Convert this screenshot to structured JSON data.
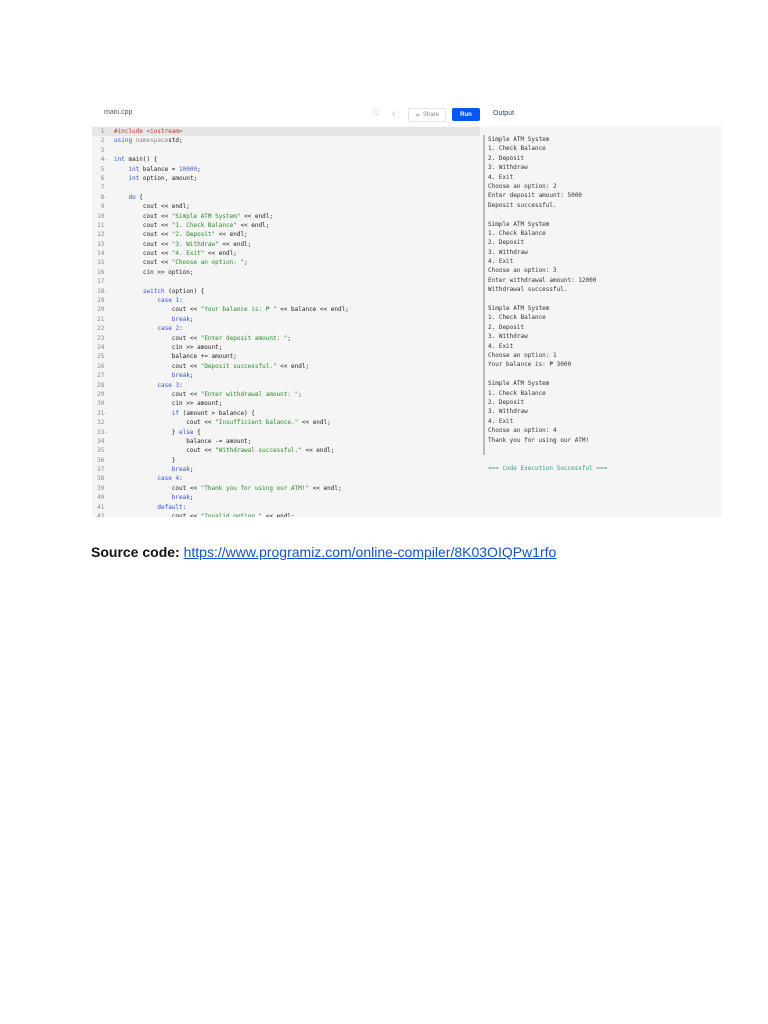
{
  "editor": {
    "filename": "main.cpp",
    "share_label": "Share",
    "run_label": "Run",
    "output_label": "Output"
  },
  "code": [
    [
      [
        "p",
        "#include <iostream>"
      ]
    ],
    [
      [
        "k",
        "using"
      ],
      [
        "g",
        " namespace"
      ],
      [
        "",
        "std;"
      ]
    ],
    [],
    [
      [
        "k",
        "int"
      ],
      [
        "",
        " main() {"
      ]
    ],
    [
      [
        "",
        "    "
      ],
      [
        "k",
        "int"
      ],
      [
        "",
        " balance = "
      ],
      [
        "n",
        "10000"
      ],
      [
        "",
        ";"
      ]
    ],
    [
      [
        "",
        "    "
      ],
      [
        "k",
        "int"
      ],
      [
        "",
        " option, amount;"
      ]
    ],
    [],
    [
      [
        "",
        "    "
      ],
      [
        "k",
        "do"
      ],
      [
        "",
        " {"
      ]
    ],
    [
      [
        "",
        "        cout << endl;"
      ]
    ],
    [
      [
        "",
        "        cout << "
      ],
      [
        "s",
        "\"Simple ATM System\""
      ],
      [
        "",
        " << endl;"
      ]
    ],
    [
      [
        "",
        "        cout << "
      ],
      [
        "s",
        "\"1. Check Balance\""
      ],
      [
        "",
        " << endl;"
      ]
    ],
    [
      [
        "",
        "        cout << "
      ],
      [
        "s",
        "\"2. Deposit\""
      ],
      [
        "",
        " << endl;"
      ]
    ],
    [
      [
        "",
        "        cout << "
      ],
      [
        "s",
        "\"3. Withdraw\""
      ],
      [
        "",
        " << endl;"
      ]
    ],
    [
      [
        "",
        "        cout << "
      ],
      [
        "s",
        "\"4. Exit\""
      ],
      [
        "",
        " << endl;"
      ]
    ],
    [
      [
        "",
        "        cout << "
      ],
      [
        "s",
        "\"Choose an option: \""
      ],
      [
        "",
        ";"
      ]
    ],
    [
      [
        "",
        "        cin >> option;"
      ]
    ],
    [],
    [
      [
        "",
        "        "
      ],
      [
        "k",
        "switch"
      ],
      [
        "",
        " (option) {"
      ]
    ],
    [
      [
        "",
        "            "
      ],
      [
        "k",
        "case"
      ],
      [
        " ",
        " "
      ],
      [
        "n",
        "1"
      ],
      [
        "",
        ":"
      ]
    ],
    [
      [
        "",
        "                cout << "
      ],
      [
        "s",
        "\"Your balance is: ₱ \""
      ],
      [
        "",
        " << balance << endl;"
      ]
    ],
    [
      [
        "",
        "                "
      ],
      [
        "k",
        "break"
      ],
      [
        "",
        ";"
      ]
    ],
    [
      [
        "",
        "            "
      ],
      [
        "k",
        "case"
      ],
      [
        "",
        " "
      ],
      [
        "n",
        "2"
      ],
      [
        "",
        ":"
      ]
    ],
    [
      [
        "",
        "                cout << "
      ],
      [
        "s",
        "\"Enter deposit amount: \""
      ],
      [
        "",
        ";"
      ]
    ],
    [
      [
        "",
        "                cin >> amount;"
      ]
    ],
    [
      [
        "",
        "                balance += amount;"
      ]
    ],
    [
      [
        "",
        "                cout << "
      ],
      [
        "s",
        "\"Deposit successful.\""
      ],
      [
        "",
        " << endl;"
      ]
    ],
    [
      [
        "",
        "                "
      ],
      [
        "k",
        "break"
      ],
      [
        "",
        ";"
      ]
    ],
    [
      [
        "",
        "            "
      ],
      [
        "k",
        "case"
      ],
      [
        "",
        " "
      ],
      [
        "n",
        "3"
      ],
      [
        "",
        ":"
      ]
    ],
    [
      [
        "",
        "                cout << "
      ],
      [
        "s",
        "\"Enter withdrawal amount: \""
      ],
      [
        "",
        ";"
      ]
    ],
    [
      [
        "",
        "                cin >> amount;"
      ]
    ],
    [
      [
        "",
        "                "
      ],
      [
        "k",
        "if"
      ],
      [
        "",
        " (amount > balance) {"
      ]
    ],
    [
      [
        "",
        "                    cout << "
      ],
      [
        "s",
        "\"Insufficient balance.\""
      ],
      [
        "",
        " << endl;"
      ]
    ],
    [
      [
        "",
        "                } "
      ],
      [
        "k",
        "else"
      ],
      [
        "",
        " {"
      ]
    ],
    [
      [
        "",
        "                    balance -= amount;"
      ]
    ],
    [
      [
        "",
        "                    cout << "
      ],
      [
        "s",
        "\"Withdrawal successful.\""
      ],
      [
        "",
        " << endl;"
      ]
    ],
    [
      [
        "",
        "                }"
      ]
    ],
    [
      [
        "",
        "                "
      ],
      [
        "k",
        "break"
      ],
      [
        "",
        ";"
      ]
    ],
    [
      [
        "",
        "            "
      ],
      [
        "k",
        "case"
      ],
      [
        "",
        " "
      ],
      [
        "n",
        "4"
      ],
      [
        "",
        ":"
      ]
    ],
    [
      [
        "",
        "                cout << "
      ],
      [
        "s",
        "\"Thank you for using our ATM!\""
      ],
      [
        "",
        " << endl;"
      ]
    ],
    [
      [
        "",
        "                "
      ],
      [
        "k",
        "break"
      ],
      [
        "",
        ";"
      ]
    ],
    [
      [
        "",
        "            "
      ],
      [
        "k",
        "default"
      ],
      [
        "",
        ":"
      ]
    ],
    [
      [
        "",
        "                cout << "
      ],
      [
        "s",
        "\"Invalid option.\""
      ],
      [
        "",
        " << endl;"
      ]
    ]
  ],
  "fold_lines": [
    4,
    8,
    18,
    31,
    33
  ],
  "output": [
    "Simple ATM System",
    "1. Check Balance",
    "2. Deposit",
    "3. Withdraw",
    "4. Exit",
    "Choose an option: 2",
    "Enter deposit amount: 5000",
    "Deposit successful.",
    "",
    "Simple ATM System",
    "1. Check Balance",
    "2. Deposit",
    "3. Withdraw",
    "4. Exit",
    "Choose an option: 3",
    "Enter withdrawal amount: 12000",
    "Withdrawal successful.",
    "",
    "Simple ATM System",
    "1. Check Balance",
    "2. Deposit",
    "3. Withdraw",
    "4. Exit",
    "Choose an option: 1",
    "Your balance is: ₱ 3000",
    "",
    "Simple ATM System",
    "1. Check Balance",
    "2. Deposit",
    "3. Withdraw",
    "4. Exit",
    "Choose an option: 4",
    "Thank you for using our ATM!",
    "",
    ""
  ],
  "output_success": "=== Code Execution Successful ===",
  "caption": {
    "label": "Source code:",
    "link": "https://www.programiz.com/online-compiler/8K03OIQPw1rfo"
  }
}
